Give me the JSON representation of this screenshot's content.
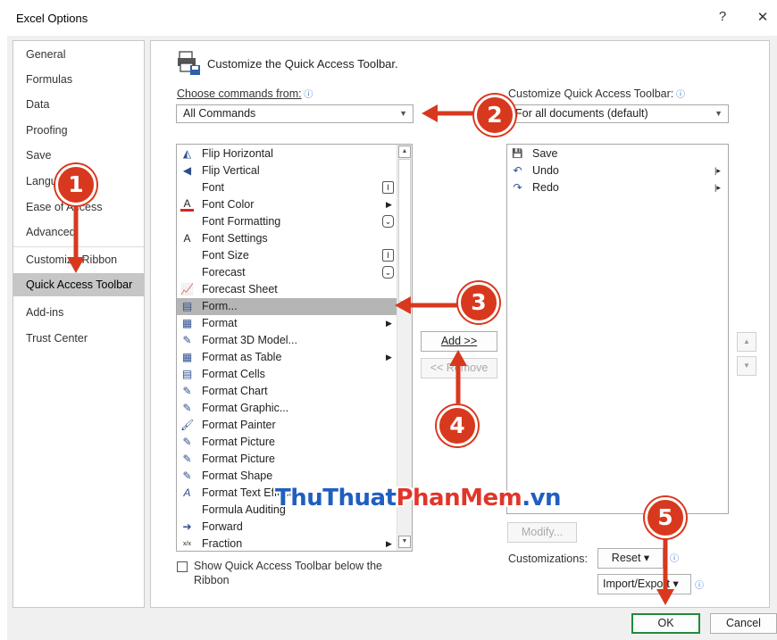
{
  "window": {
    "title": "Excel Options",
    "help": "?",
    "close": "✕"
  },
  "sidebar": {
    "items": [
      {
        "label": "General"
      },
      {
        "label": "Formulas"
      },
      {
        "label": "Data"
      },
      {
        "label": "Proofing"
      },
      {
        "label": "Save"
      },
      {
        "label": "Language"
      },
      {
        "label": "Ease of Access"
      },
      {
        "label": "Advanced"
      },
      {
        "label": "Customize Ribbon"
      },
      {
        "label": "Quick Access Toolbar",
        "selected": true
      },
      {
        "label": "Add-ins"
      },
      {
        "label": "Trust Center"
      }
    ]
  },
  "main": {
    "heading": "Customize the Quick Access Toolbar.",
    "choose_label": "Choose commands from:",
    "choose_value": "All Commands",
    "customize_label": "Customize Quick Access Toolbar:",
    "customize_value": "For all documents (default)",
    "commands": [
      {
        "label": "Flip Horizontal",
        "icon": "flip-horizontal-icon",
        "glyph": "◭"
      },
      {
        "label": "Flip Vertical",
        "icon": "flip-vertical-icon",
        "glyph": "◀"
      },
      {
        "label": "Font",
        "icon": "",
        "glyph": ""
      },
      {
        "label": "Font Color",
        "icon": "font-color-icon",
        "glyph": "A"
      },
      {
        "label": "Font Formatting",
        "icon": "",
        "glyph": ""
      },
      {
        "label": "Font Settings",
        "icon": "font-settings-icon",
        "glyph": "A"
      },
      {
        "label": "Font Size",
        "icon": "",
        "glyph": ""
      },
      {
        "label": "Forecast",
        "icon": "",
        "glyph": ""
      },
      {
        "label": "Forecast Sheet",
        "icon": "forecast-sheet-icon",
        "glyph": "📈"
      },
      {
        "label": "Form...",
        "icon": "form-icon",
        "glyph": "▤",
        "highlighted": true
      },
      {
        "label": "Format",
        "icon": "format-icon",
        "glyph": "▦"
      },
      {
        "label": "Format 3D Model...",
        "icon": "format-3d-model-icon",
        "glyph": "✎"
      },
      {
        "label": "Format as Table",
        "icon": "format-as-table-icon",
        "glyph": "▦"
      },
      {
        "label": "Format Cells",
        "icon": "format-cells-icon",
        "glyph": "▤"
      },
      {
        "label": "Format Chart",
        "icon": "format-chart-icon",
        "glyph": "✎"
      },
      {
        "label": "Format Graphic...",
        "icon": "format-graphic-icon",
        "glyph": "✎"
      },
      {
        "label": "Format Painter",
        "icon": "format-painter-icon",
        "glyph": "🖌"
      },
      {
        "label": "Format Picture",
        "icon": "format-picture-icon",
        "glyph": "✎"
      },
      {
        "label": "Format Picture",
        "icon": "format-picture-icon",
        "glyph": "✎"
      },
      {
        "label": "Format Shape",
        "icon": "format-shape-icon",
        "glyph": "✎"
      },
      {
        "label": "Format Text Effects",
        "icon": "format-text-effects-icon",
        "glyph": "A"
      },
      {
        "label": "Formula Auditing",
        "icon": "",
        "glyph": ""
      },
      {
        "label": "Forward",
        "icon": "forward-icon",
        "glyph": "➔"
      },
      {
        "label": "Fraction",
        "icon": "fraction-icon",
        "glyph": "x/x"
      }
    ],
    "toolbar_items": [
      {
        "label": "Save",
        "icon": "save-icon",
        "glyph": "💾"
      },
      {
        "label": "Undo",
        "icon": "undo-icon",
        "glyph": "↶"
      },
      {
        "label": "Redo",
        "icon": "redo-icon",
        "glyph": "↷"
      }
    ],
    "add_button": "Add >>",
    "remove_button": "<< Remove",
    "modify_button": "Modify...",
    "customizations_label": "Customizations:",
    "reset_button": "Reset ▾",
    "import_export_button": "Import/Export ▾",
    "show_below_label_line1": "Show Quick Access Toolbar below the",
    "show_below_label_line2": "Ribbon"
  },
  "footer": {
    "ok": "OK",
    "cancel": "Cancel"
  },
  "annotations": {
    "step1": "1",
    "step2": "2",
    "step3": "3",
    "step4": "4",
    "step5": "5"
  },
  "watermark": {
    "part1": "ThuThuat",
    "part2": "PhanMem",
    "part3": ".vn"
  },
  "colors": {
    "callout": "#d8391e",
    "watermark_blue": "#1f5fbf",
    "watermark_red": "#e0362a",
    "selection": "#c6c6c6",
    "ok_border": "#1e8c3a"
  }
}
